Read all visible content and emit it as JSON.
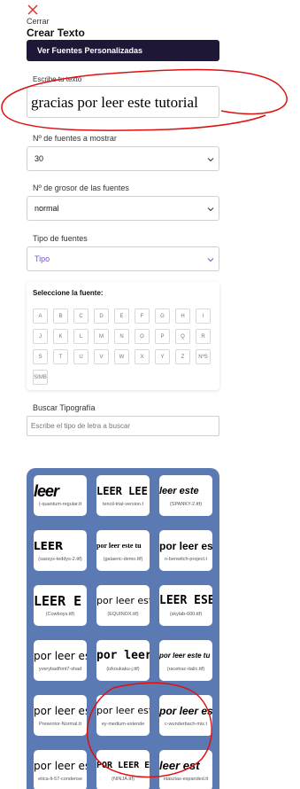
{
  "header": {
    "close_label": "Cerrar",
    "title": "Crear Texto"
  },
  "custom_fonts_button": "Ver Fuentes Personalizadas",
  "text_field": {
    "label": "Escribe tu texto",
    "value": "gracias por leer este tutorial"
  },
  "fonts_count": {
    "label": "Nº de fuentes a mostrar",
    "value": "30"
  },
  "weight": {
    "label": "Nº de grosor de las fuentes",
    "value": "normal"
  },
  "font_type": {
    "label": "Tipo de fuentes",
    "value": "Tipo"
  },
  "letter_panel": {
    "title": "Seleccione la fuente:",
    "letters": [
      "A",
      "B",
      "C",
      "D",
      "E",
      "F",
      "G",
      "H",
      "I",
      "J",
      "K",
      "L",
      "M",
      "N",
      "O",
      "P",
      "Q",
      "R",
      "S",
      "T",
      "U",
      "V",
      "W",
      "X",
      "Y",
      "Z",
      "NºS",
      "SIMB"
    ]
  },
  "search": {
    "label": "Buscar Tipografía",
    "placeholder": "Escribe el tipo de letra a buscar"
  },
  "fonts": [
    {
      "preview": "leer",
      "caption": "(-quantum-regular.tt"
    },
    {
      "preview": "LEER LEE",
      "caption": "tencil-trial-version.t"
    },
    {
      "preview": "leer este",
      "caption": "(SPANKY-2.ttf)"
    },
    {
      "preview": "LEER",
      "caption": "(sassys-teddys-2.ttf)"
    },
    {
      "preview": "por leer este tu",
      "caption": "(galaeric-demo.ttf)"
    },
    {
      "preview": "por leer est",
      "caption": "n-benwitch-project.t"
    },
    {
      "preview": "LEER E",
      "caption": "(Cowboys.ttf)"
    },
    {
      "preview": "por leer est",
      "caption": "(EQUINOX.ttf)"
    },
    {
      "preview": "LEER ESE",
      "caption": "(skylab-600.ttf)"
    },
    {
      "preview": "por leer este",
      "caption": "yverybadfont7-shad"
    },
    {
      "preview": "por leer",
      "caption": "(izkoukaku-j.ttf)"
    },
    {
      "preview": "por leer este tu",
      "caption": "(racetrac-italic.ttf)"
    },
    {
      "preview": "por leer este",
      "caption": "Presentor-Normal.tt"
    },
    {
      "preview": "por leer este",
      "caption": "ey-medium-extende"
    },
    {
      "preview": "por leer este",
      "caption": "c-wunderbach-mix.t"
    },
    {
      "preview": "por leer este",
      "caption": "etica-lt-57-condense"
    },
    {
      "preview": "POR LEER ESTE",
      "caption": "(NINJA.ttf)"
    },
    {
      "preview": "leer est",
      "caption": "ntaszias-expanded.tt"
    }
  ],
  "colors": {
    "dark_button": "#1e1836",
    "panel_blue": "#5b79b3",
    "annotation_red": "#e01010",
    "close_red": "#d9342b",
    "type_purple": "#7a4fd0"
  }
}
